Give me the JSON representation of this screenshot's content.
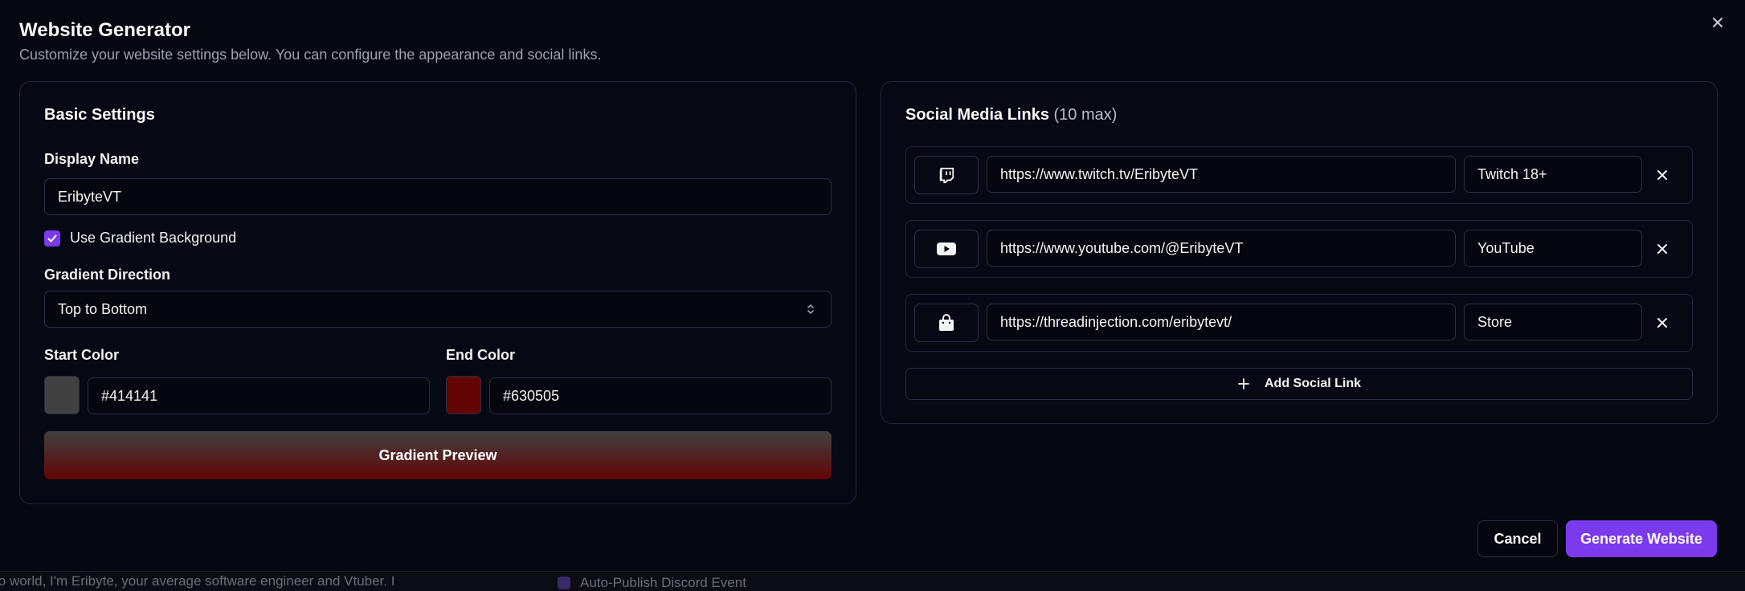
{
  "dialog": {
    "title": "Website Generator",
    "subtitle": "Customize your website settings below. You can configure the appearance and social links."
  },
  "basic": {
    "title": "Basic Settings",
    "display_name_label": "Display Name",
    "display_name_value": "EribyteVT",
    "gradient_checkbox_label": "Use Gradient Background",
    "gradient_checked": true,
    "gradient_direction_label": "Gradient Direction",
    "gradient_direction_value": "Top to Bottom",
    "start_color_label": "Start Color",
    "start_color_value": "#414141",
    "end_color_label": "End Color",
    "end_color_value": "#630505",
    "preview_label": "Gradient Preview"
  },
  "social": {
    "title": "Social Media Links",
    "title_suffix": "(10 max)",
    "links": [
      {
        "icon": "twitch-icon",
        "url": "https://www.twitch.tv/EribyteVT",
        "label": "Twitch 18+"
      },
      {
        "icon": "youtube-icon",
        "url": "https://www.youtube.com/@EribyteVT",
        "label": "YouTube"
      },
      {
        "icon": "shopping-bag-icon",
        "url": "https://threadinjection.com/eribytevt/",
        "label": "Store"
      }
    ],
    "add_label": "Add Social Link"
  },
  "footer": {
    "cancel_label": "Cancel",
    "generate_label": "Generate Website"
  },
  "background": {
    "left_text": "lo world, I'm Eribyte, your average software engineer and Vtuber. I",
    "right_text": "Auto-Publish Discord Event"
  },
  "colors": {
    "accent": "#7c3aed",
    "gradient_start": "#414141",
    "gradient_end": "#630505"
  }
}
